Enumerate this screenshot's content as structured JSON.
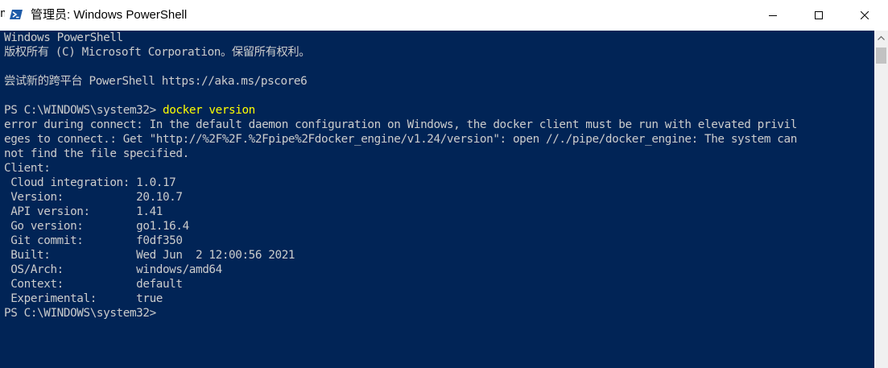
{
  "window": {
    "title": "管理员: Windows PowerShell",
    "edge_glyph": "n"
  },
  "icons": {
    "app": "powershell-icon",
    "minimize": "minimize-icon",
    "maximize": "maximize-icon",
    "close": "close-icon",
    "scroll_up": "chevron-up-icon"
  },
  "colors": {
    "terminal_background": "#012456",
    "terminal_text": "#cccccc",
    "command_text": "#ffff00"
  },
  "terminal": {
    "lines": [
      "Windows PowerShell",
      "版权所有 (C) Microsoft Corporation。保留所有权利。",
      "",
      "尝试新的跨平台 PowerShell https://aka.ms/pscore6",
      "",
      "",
      "error during connect: In the default daemon configuration on Windows, the docker client must be run with elevated privil",
      "eges to connect.: Get \"http://%2F%2F.%2Fpipe%2Fdocker_engine/v1.24/version\": open //./pipe/docker_engine: The system can",
      "not find the file specified.",
      "Client:",
      " Cloud integration: 1.0.17",
      " Version:           20.10.7",
      " API version:       1.41",
      " Go version:        go1.16.4",
      " Git commit:        f0df350",
      " Built:             Wed Jun  2 12:00:56 2021",
      " OS/Arch:           windows/amd64",
      " Context:           default",
      " Experimental:      true",
      "PS C:\\WINDOWS\\system32>"
    ],
    "prompt_line": {
      "prompt": "PS C:\\WINDOWS\\system32> ",
      "command": "docker version"
    }
  }
}
